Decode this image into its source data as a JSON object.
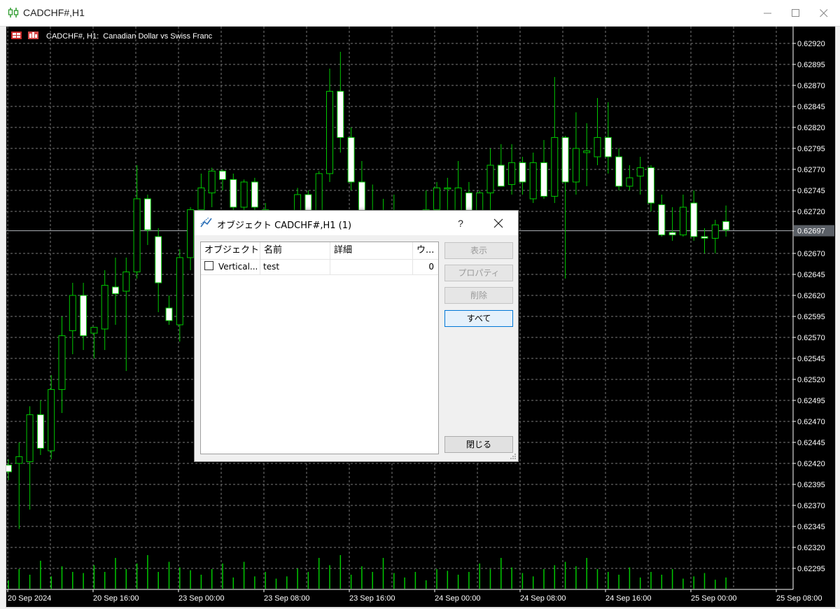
{
  "window": {
    "title": "CADCHF#,H1",
    "controls": [
      "minimize",
      "maximize",
      "close"
    ]
  },
  "chart": {
    "label": "CADCHF#, H1:  Canadian Dollar vs Swiss Franc",
    "current_price": "0.62697",
    "colors": {
      "background": "#000000",
      "grid": "#7a7a7a",
      "bull": "#00c800",
      "body_up": "#000000",
      "body_down": "#ffffff",
      "volume": "#00c800",
      "axis_text": "#ffffff",
      "price_tag_bg": "#5a5f66"
    }
  },
  "chart_data": {
    "type": "candlestick",
    "symbol": "CADCHF#",
    "timeframe": "H1",
    "ylim": [
      0.6227,
      0.6294
    ],
    "y_ticks": [
      "0.62920",
      "0.62895",
      "0.62870",
      "0.62845",
      "0.62820",
      "0.62795",
      "0.62770",
      "0.62745",
      "0.62720",
      "0.62697",
      "0.62670",
      "0.62645",
      "0.62620",
      "0.62595",
      "0.62570",
      "0.62545",
      "0.62520",
      "0.62495",
      "0.62470",
      "0.62445",
      "0.62420",
      "0.62395",
      "0.62370",
      "0.62345",
      "0.62320",
      "0.62295"
    ],
    "x_ticks": [
      "20 Sep 2024",
      "20 Sep 16:00",
      "23 Sep 00:00",
      "23 Sep 08:00",
      "23 Sep 16:00",
      "24 Sep 00:00",
      "24 Sep 08:00",
      "24 Sep 16:00",
      "25 Sep 00:00",
      "25 Sep 08:00"
    ],
    "candles": [
      {
        "o": 0.62418,
        "h": 0.62425,
        "l": 0.624,
        "c": 0.6241
      },
      {
        "o": 0.6242,
        "h": 0.62445,
        "l": 0.62342,
        "c": 0.62428
      },
      {
        "o": 0.62422,
        "h": 0.62488,
        "l": 0.62365,
        "c": 0.62478
      },
      {
        "o": 0.62478,
        "h": 0.62495,
        "l": 0.6243,
        "c": 0.62438
      },
      {
        "o": 0.62435,
        "h": 0.62525,
        "l": 0.62425,
        "c": 0.62508
      },
      {
        "o": 0.62508,
        "h": 0.62595,
        "l": 0.6248,
        "c": 0.62572
      },
      {
        "o": 0.62578,
        "h": 0.62635,
        "l": 0.6255,
        "c": 0.6262
      },
      {
        "o": 0.6262,
        "h": 0.62635,
        "l": 0.62555,
        "c": 0.62572
      },
      {
        "o": 0.62575,
        "h": 0.6258,
        "l": 0.62545,
        "c": 0.62582
      },
      {
        "o": 0.6258,
        "h": 0.6265,
        "l": 0.62555,
        "c": 0.62632
      },
      {
        "o": 0.6263,
        "h": 0.62665,
        "l": 0.62585,
        "c": 0.62622
      },
      {
        "o": 0.62625,
        "h": 0.62665,
        "l": 0.6253,
        "c": 0.62648
      },
      {
        "o": 0.62648,
        "h": 0.62775,
        "l": 0.6264,
        "c": 0.62735
      },
      {
        "o": 0.62735,
        "h": 0.6274,
        "l": 0.6268,
        "c": 0.62698
      },
      {
        "o": 0.6269,
        "h": 0.627,
        "l": 0.626,
        "c": 0.62635
      },
      {
        "o": 0.62605,
        "h": 0.6262,
        "l": 0.62585,
        "c": 0.6259
      },
      {
        "o": 0.62585,
        "h": 0.62675,
        "l": 0.62565,
        "c": 0.62665
      },
      {
        "o": 0.62665,
        "h": 0.62725,
        "l": 0.6265,
        "c": 0.62722
      },
      {
        "o": 0.62722,
        "h": 0.62765,
        "l": 0.62705,
        "c": 0.62748
      },
      {
        "o": 0.62742,
        "h": 0.62772,
        "l": 0.62725,
        "c": 0.62768
      },
      {
        "o": 0.62768,
        "h": 0.6277,
        "l": 0.62745,
        "c": 0.62758
      },
      {
        "o": 0.62758,
        "h": 0.62765,
        "l": 0.62705,
        "c": 0.62725
      },
      {
        "o": 0.62725,
        "h": 0.62758,
        "l": 0.627,
        "c": 0.62755
      },
      {
        "o": 0.62755,
        "h": 0.6276,
        "l": 0.627,
        "c": 0.62725
      },
      {
        "o": 0.62722,
        "h": 0.6273,
        "l": 0.6269,
        "c": 0.62715
      },
      {
        "o": 0.62705,
        "h": 0.6272,
        "l": 0.6265,
        "c": 0.6269
      },
      {
        "o": 0.6269,
        "h": 0.6271,
        "l": 0.6266,
        "c": 0.62698
      },
      {
        "o": 0.62695,
        "h": 0.62748,
        "l": 0.6268,
        "c": 0.6274
      },
      {
        "o": 0.6274,
        "h": 0.62745,
        "l": 0.6267,
        "c": 0.6269
      },
      {
        "o": 0.6269,
        "h": 0.62768,
        "l": 0.6268,
        "c": 0.62765
      },
      {
        "o": 0.62765,
        "h": 0.6289,
        "l": 0.62755,
        "c": 0.62863
      },
      {
        "o": 0.62863,
        "h": 0.6291,
        "l": 0.6279,
        "c": 0.62808
      },
      {
        "o": 0.62808,
        "h": 0.6282,
        "l": 0.62745,
        "c": 0.62755
      },
      {
        "o": 0.62755,
        "h": 0.6278,
        "l": 0.62705,
        "c": 0.62712
      },
      {
        "o": 0.62712,
        "h": 0.62752,
        "l": 0.6269,
        "c": 0.627
      },
      {
        "o": 0.627,
        "h": 0.62735,
        "l": 0.6269,
        "c": 0.62718
      },
      {
        "o": 0.62718,
        "h": 0.6274,
        "l": 0.6268,
        "c": 0.627
      },
      {
        "o": 0.627,
        "h": 0.6272,
        "l": 0.62655,
        "c": 0.62676
      },
      {
        "o": 0.62676,
        "h": 0.6272,
        "l": 0.6266,
        "c": 0.62712
      },
      {
        "o": 0.62712,
        "h": 0.62745,
        "l": 0.6269,
        "c": 0.62722
      },
      {
        "o": 0.62722,
        "h": 0.62755,
        "l": 0.627,
        "c": 0.62748
      },
      {
        "o": 0.62748,
        "h": 0.6276,
        "l": 0.62715,
        "c": 0.62748
      },
      {
        "o": 0.62668,
        "h": 0.6278,
        "l": 0.6266,
        "c": 0.62748
      },
      {
        "o": 0.62742,
        "h": 0.62755,
        "l": 0.62695,
        "c": 0.62705
      },
      {
        "o": 0.62705,
        "h": 0.62745,
        "l": 0.627,
        "c": 0.62742
      },
      {
        "o": 0.62742,
        "h": 0.62795,
        "l": 0.62715,
        "c": 0.62775
      },
      {
        "o": 0.62775,
        "h": 0.628,
        "l": 0.6275,
        "c": 0.6275
      },
      {
        "o": 0.62752,
        "h": 0.628,
        "l": 0.6274,
        "c": 0.62778
      },
      {
        "o": 0.62778,
        "h": 0.62785,
        "l": 0.6274,
        "c": 0.62755
      },
      {
        "o": 0.62735,
        "h": 0.6279,
        "l": 0.6273,
        "c": 0.62778
      },
      {
        "o": 0.62778,
        "h": 0.62805,
        "l": 0.62735,
        "c": 0.62738
      },
      {
        "o": 0.62738,
        "h": 0.6288,
        "l": 0.6273,
        "c": 0.62808
      },
      {
        "o": 0.62808,
        "h": 0.6281,
        "l": 0.6264,
        "c": 0.62755
      },
      {
        "o": 0.62755,
        "h": 0.62838,
        "l": 0.6274,
        "c": 0.62795
      },
      {
        "o": 0.6279,
        "h": 0.62825,
        "l": 0.6275,
        "c": 0.62792
      },
      {
        "o": 0.62785,
        "h": 0.62855,
        "l": 0.62775,
        "c": 0.62808
      },
      {
        "o": 0.62808,
        "h": 0.6285,
        "l": 0.62765,
        "c": 0.62785
      },
      {
        "o": 0.62785,
        "h": 0.62795,
        "l": 0.62745,
        "c": 0.6275
      },
      {
        "o": 0.6275,
        "h": 0.62775,
        "l": 0.62745,
        "c": 0.6276
      },
      {
        "o": 0.62762,
        "h": 0.62785,
        "l": 0.6274,
        "c": 0.62772
      },
      {
        "o": 0.62772,
        "h": 0.62775,
        "l": 0.6272,
        "c": 0.6273
      },
      {
        "o": 0.62728,
        "h": 0.6274,
        "l": 0.6269,
        "c": 0.62692
      },
      {
        "o": 0.62695,
        "h": 0.62725,
        "l": 0.62685,
        "c": 0.62692
      },
      {
        "o": 0.62692,
        "h": 0.6274,
        "l": 0.6269,
        "c": 0.62725
      },
      {
        "o": 0.6273,
        "h": 0.62745,
        "l": 0.62685,
        "c": 0.6269
      },
      {
        "o": 0.6269,
        "h": 0.627,
        "l": 0.6267,
        "c": 0.62688
      },
      {
        "o": 0.62688,
        "h": 0.6271,
        "l": 0.6267,
        "c": 0.62704
      },
      {
        "o": 0.62708,
        "h": 0.62727,
        "l": 0.6269,
        "c": 0.62698
      }
    ],
    "volumes": [
      0.15,
      0.35,
      0.25,
      0.5,
      0.22,
      0.4,
      0.3,
      0.28,
      0.42,
      0.3,
      0.55,
      0.35,
      0.45,
      0.6,
      0.3,
      0.48,
      0.38,
      0.33,
      0.25,
      0.35,
      0.45,
      0.2,
      0.48,
      0.22,
      0.3,
      0.18,
      0.22,
      0.36,
      0.3,
      0.55,
      0.42,
      0.6,
      0.25,
      0.4,
      0.3,
      0.55,
      0.28,
      0.2,
      0.3,
      0.15,
      0.35,
      0.32,
      0.25,
      0.3,
      0.45,
      0.35,
      0.55,
      0.38,
      0.28,
      0.22,
      0.35,
      0.42,
      0.48,
      0.4,
      0.55,
      0.35,
      0.3,
      0.25,
      0.38,
      0.2,
      0.3,
      0.25,
      0.35,
      0.18,
      0.22,
      0.28,
      0.16,
      0.2
    ]
  },
  "dialog": {
    "title": "オブジェクト CADCHF#,H1 (1)",
    "help": "?",
    "columns": [
      "オブジェクト",
      "名前",
      "詳細",
      "ウ..."
    ],
    "rows": [
      {
        "object": "Vertical...",
        "name": "test",
        "details": "",
        "window": "0",
        "checked": false
      }
    ],
    "buttons": {
      "show": "表示",
      "properties": "プロパティ",
      "delete": "削除",
      "all": "すべて",
      "close": "閉じる"
    }
  }
}
